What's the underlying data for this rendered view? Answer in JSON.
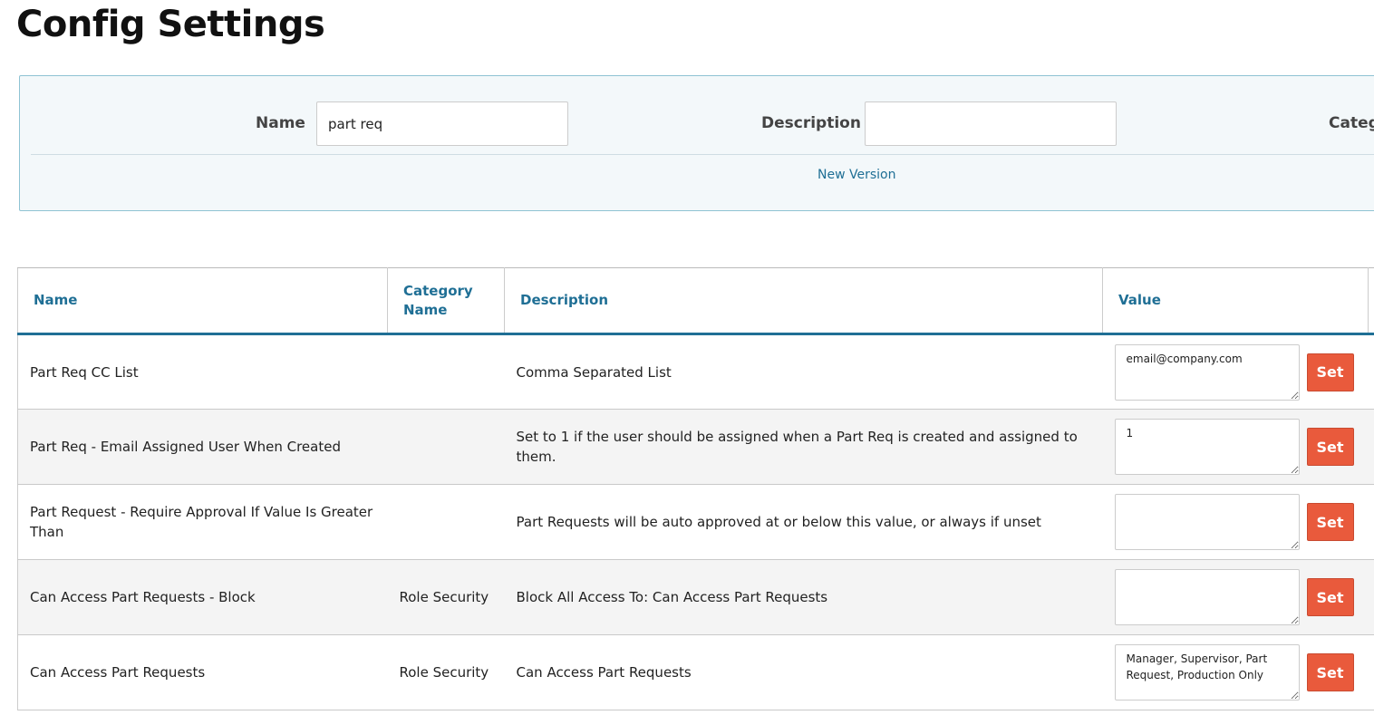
{
  "page": {
    "title": "Config Settings"
  },
  "filters": {
    "name_label": "Name",
    "name_value": "part req",
    "description_label": "Description",
    "description_value": "",
    "category_label": "Categ",
    "new_version_label": "New Version"
  },
  "table": {
    "columns": [
      "Name",
      "Category Name",
      "Description",
      "Value"
    ],
    "set_label": "Set",
    "rows": [
      {
        "name": "Part Req CC List",
        "category": "",
        "description": "Comma Separated List",
        "value": "email@company.com"
      },
      {
        "name": "Part Req - Email Assigned User When Created",
        "category": "",
        "description": "Set to 1 if the user should be assigned when a Part Req is created and assigned to them.",
        "value": "1"
      },
      {
        "name": "Part Request - Require Approval If Value Is Greater Than",
        "category": "",
        "description": "Part Requests will be auto approved at or below this value, or always if unset",
        "value": ""
      },
      {
        "name": "Can Access Part Requests - Block",
        "category": "Role Security",
        "description": "Block All Access To: Can Access Part Requests",
        "value": ""
      },
      {
        "name": "Can Access Part Requests",
        "category": "Role Security",
        "description": "Can Access Part Requests",
        "value": "Manager, Supervisor, Part Request, Production Only"
      }
    ]
  },
  "colors": {
    "accent": "#1f6f95",
    "set_button": "#e95a3c",
    "panel_border": "#8fc3d3"
  }
}
